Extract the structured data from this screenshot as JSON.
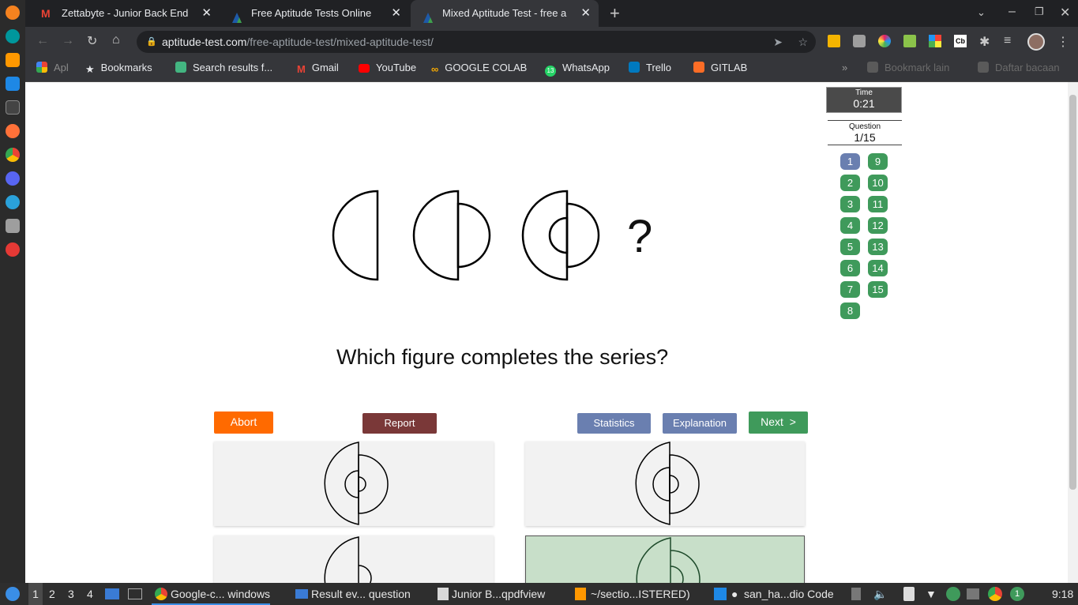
{
  "browser": {
    "tabs": [
      {
        "title": "Zettabyte - Junior Back End",
        "favicon": "gmail-icon"
      },
      {
        "title": "Free Aptitude Tests Online",
        "favicon": "aptitude-icon"
      },
      {
        "title": "Mixed Aptitude Test - free a",
        "favicon": "aptitude-icon"
      }
    ],
    "url_host": "aptitude-test.com",
    "url_path": "/free-aptitude-test/mixed-aptitude-test/",
    "bookmarks": [
      "Apl",
      "Bookmarks",
      "Search results f...",
      "Gmail",
      "YouTube",
      "GOOGLE COLAB",
      "WhatsApp",
      "Trello",
      "GITLAB"
    ],
    "bookmarks_right": [
      "Bookmark lain",
      "Daftar bacaan"
    ],
    "whatsapp_badge": "13"
  },
  "quiz": {
    "timer_label": "Time",
    "timer_value": "0:21",
    "question_label": "Question",
    "question_value": "1/15",
    "question_numbers": [
      "1",
      "2",
      "3",
      "4",
      "5",
      "6",
      "7",
      "8",
      "9",
      "10",
      "11",
      "12",
      "13",
      "14",
      "15"
    ],
    "current_question": "1",
    "question_mark": "?",
    "prompt": "Which figure completes the series?",
    "buttons": {
      "abort": "Abort",
      "report": "Report",
      "statistics": "Statistics",
      "explanation": "Explanation",
      "next": "Next  >"
    },
    "colors": {
      "abort": "#ff6a00",
      "report": "#7a3838",
      "stats": "#6a7fb0",
      "next": "#3f9a5b",
      "selected_option": "#c8dfc9"
    }
  },
  "taskbar": {
    "workspaces": [
      "1",
      "2",
      "3",
      "4"
    ],
    "apps": [
      "Google-c... windows",
      "Result ev... question",
      "Junior B...qpdfview",
      "~/sectio...ISTERED)",
      "san_ha...dio Code"
    ],
    "notification_badge": "1",
    "clock": "9:18"
  }
}
